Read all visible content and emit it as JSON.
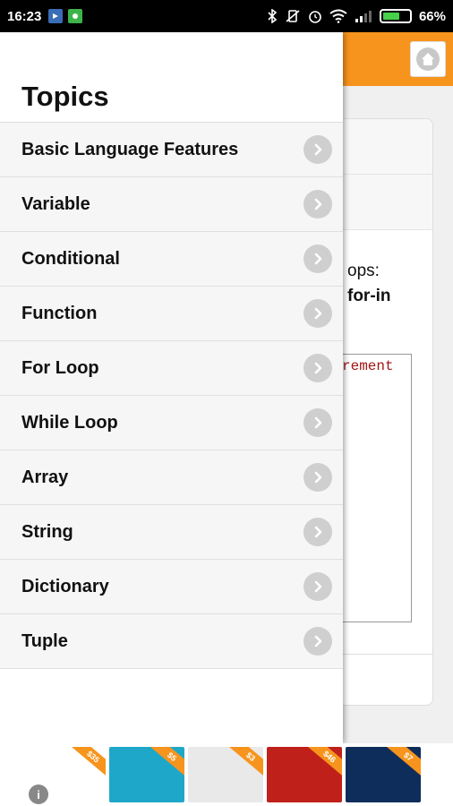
{
  "status_bar": {
    "time": "16:23",
    "battery_percent": "66%",
    "battery_level": 0.66
  },
  "background_page": {
    "visible_text_1": "ops:",
    "visible_text_2": "for-in",
    "visible_code": "rement"
  },
  "drawer": {
    "title": "Topics",
    "items": [
      {
        "label": "Basic Language Features"
      },
      {
        "label": "Variable"
      },
      {
        "label": "Conditional"
      },
      {
        "label": "Function"
      },
      {
        "label": "For Loop"
      },
      {
        "label": "While Loop"
      },
      {
        "label": "Array"
      },
      {
        "label": "String"
      },
      {
        "label": "Dictionary"
      },
      {
        "label": "Tuple"
      }
    ]
  },
  "ads": [
    {
      "ribbon": "$35",
      "color": "#ffffff"
    },
    {
      "ribbon": "$5",
      "color": "#1fa7c9"
    },
    {
      "ribbon": "$3",
      "color": "#e9e9e9"
    },
    {
      "ribbon": "$46",
      "color": "#c0201a"
    },
    {
      "ribbon": "$7",
      "color": "#0f2d5a"
    }
  ],
  "colors": {
    "header": "#f7941d",
    "drawer_item_bg": "#f6f6f6"
  }
}
